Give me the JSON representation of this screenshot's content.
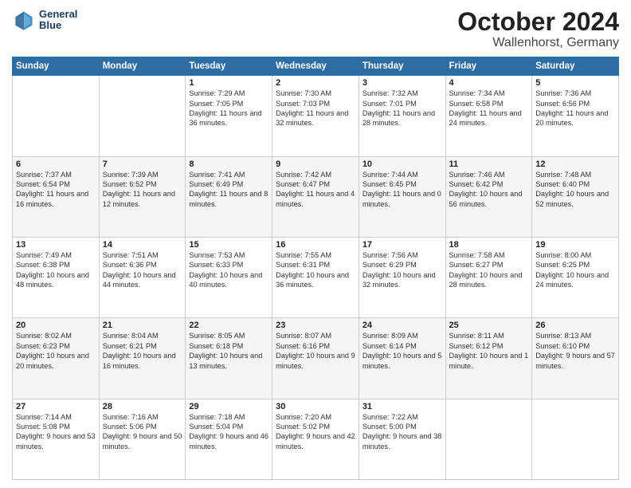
{
  "logo": {
    "line1": "General",
    "line2": "Blue"
  },
  "title": "October 2024",
  "subtitle": "Wallenhorst, Germany",
  "days_of_week": [
    "Sunday",
    "Monday",
    "Tuesday",
    "Wednesday",
    "Thursday",
    "Friday",
    "Saturday"
  ],
  "weeks": [
    [
      {
        "day": "",
        "sunrise": "",
        "sunset": "",
        "daylight": ""
      },
      {
        "day": "",
        "sunrise": "",
        "sunset": "",
        "daylight": ""
      },
      {
        "day": "1",
        "sunrise": "Sunrise: 7:29 AM",
        "sunset": "Sunset: 7:05 PM",
        "daylight": "Daylight: 11 hours and 36 minutes."
      },
      {
        "day": "2",
        "sunrise": "Sunrise: 7:30 AM",
        "sunset": "Sunset: 7:03 PM",
        "daylight": "Daylight: 11 hours and 32 minutes."
      },
      {
        "day": "3",
        "sunrise": "Sunrise: 7:32 AM",
        "sunset": "Sunset: 7:01 PM",
        "daylight": "Daylight: 11 hours and 28 minutes."
      },
      {
        "day": "4",
        "sunrise": "Sunrise: 7:34 AM",
        "sunset": "Sunset: 6:58 PM",
        "daylight": "Daylight: 11 hours and 24 minutes."
      },
      {
        "day": "5",
        "sunrise": "Sunrise: 7:36 AM",
        "sunset": "Sunset: 6:56 PM",
        "daylight": "Daylight: 11 hours and 20 minutes."
      }
    ],
    [
      {
        "day": "6",
        "sunrise": "Sunrise: 7:37 AM",
        "sunset": "Sunset: 6:54 PM",
        "daylight": "Daylight: 11 hours and 16 minutes."
      },
      {
        "day": "7",
        "sunrise": "Sunrise: 7:39 AM",
        "sunset": "Sunset: 6:52 PM",
        "daylight": "Daylight: 11 hours and 12 minutes."
      },
      {
        "day": "8",
        "sunrise": "Sunrise: 7:41 AM",
        "sunset": "Sunset: 6:49 PM",
        "daylight": "Daylight: 11 hours and 8 minutes."
      },
      {
        "day": "9",
        "sunrise": "Sunrise: 7:42 AM",
        "sunset": "Sunset: 6:47 PM",
        "daylight": "Daylight: 11 hours and 4 minutes."
      },
      {
        "day": "10",
        "sunrise": "Sunrise: 7:44 AM",
        "sunset": "Sunset: 6:45 PM",
        "daylight": "Daylight: 11 hours and 0 minutes."
      },
      {
        "day": "11",
        "sunrise": "Sunrise: 7:46 AM",
        "sunset": "Sunset: 6:42 PM",
        "daylight": "Daylight: 10 hours and 56 minutes."
      },
      {
        "day": "12",
        "sunrise": "Sunrise: 7:48 AM",
        "sunset": "Sunset: 6:40 PM",
        "daylight": "Daylight: 10 hours and 52 minutes."
      }
    ],
    [
      {
        "day": "13",
        "sunrise": "Sunrise: 7:49 AM",
        "sunset": "Sunset: 6:38 PM",
        "daylight": "Daylight: 10 hours and 48 minutes."
      },
      {
        "day": "14",
        "sunrise": "Sunrise: 7:51 AM",
        "sunset": "Sunset: 6:36 PM",
        "daylight": "Daylight: 10 hours and 44 minutes."
      },
      {
        "day": "15",
        "sunrise": "Sunrise: 7:53 AM",
        "sunset": "Sunset: 6:33 PM",
        "daylight": "Daylight: 10 hours and 40 minutes."
      },
      {
        "day": "16",
        "sunrise": "Sunrise: 7:55 AM",
        "sunset": "Sunset: 6:31 PM",
        "daylight": "Daylight: 10 hours and 36 minutes."
      },
      {
        "day": "17",
        "sunrise": "Sunrise: 7:56 AM",
        "sunset": "Sunset: 6:29 PM",
        "daylight": "Daylight: 10 hours and 32 minutes."
      },
      {
        "day": "18",
        "sunrise": "Sunrise: 7:58 AM",
        "sunset": "Sunset: 6:27 PM",
        "daylight": "Daylight: 10 hours and 28 minutes."
      },
      {
        "day": "19",
        "sunrise": "Sunrise: 8:00 AM",
        "sunset": "Sunset: 6:25 PM",
        "daylight": "Daylight: 10 hours and 24 minutes."
      }
    ],
    [
      {
        "day": "20",
        "sunrise": "Sunrise: 8:02 AM",
        "sunset": "Sunset: 6:23 PM",
        "daylight": "Daylight: 10 hours and 20 minutes."
      },
      {
        "day": "21",
        "sunrise": "Sunrise: 8:04 AM",
        "sunset": "Sunset: 6:21 PM",
        "daylight": "Daylight: 10 hours and 16 minutes."
      },
      {
        "day": "22",
        "sunrise": "Sunrise: 8:05 AM",
        "sunset": "Sunset: 6:18 PM",
        "daylight": "Daylight: 10 hours and 13 minutes."
      },
      {
        "day": "23",
        "sunrise": "Sunrise: 8:07 AM",
        "sunset": "Sunset: 6:16 PM",
        "daylight": "Daylight: 10 hours and 9 minutes."
      },
      {
        "day": "24",
        "sunrise": "Sunrise: 8:09 AM",
        "sunset": "Sunset: 6:14 PM",
        "daylight": "Daylight: 10 hours and 5 minutes."
      },
      {
        "day": "25",
        "sunrise": "Sunrise: 8:11 AM",
        "sunset": "Sunset: 6:12 PM",
        "daylight": "Daylight: 10 hours and 1 minute."
      },
      {
        "day": "26",
        "sunrise": "Sunrise: 8:13 AM",
        "sunset": "Sunset: 6:10 PM",
        "daylight": "Daylight: 9 hours and 57 minutes."
      }
    ],
    [
      {
        "day": "27",
        "sunrise": "Sunrise: 7:14 AM",
        "sunset": "Sunset: 5:08 PM",
        "daylight": "Daylight: 9 hours and 53 minutes."
      },
      {
        "day": "28",
        "sunrise": "Sunrise: 7:16 AM",
        "sunset": "Sunset: 5:06 PM",
        "daylight": "Daylight: 9 hours and 50 minutes."
      },
      {
        "day": "29",
        "sunrise": "Sunrise: 7:18 AM",
        "sunset": "Sunset: 5:04 PM",
        "daylight": "Daylight: 9 hours and 46 minutes."
      },
      {
        "day": "30",
        "sunrise": "Sunrise: 7:20 AM",
        "sunset": "Sunset: 5:02 PM",
        "daylight": "Daylight: 9 hours and 42 minutes."
      },
      {
        "day": "31",
        "sunrise": "Sunrise: 7:22 AM",
        "sunset": "Sunset: 5:00 PM",
        "daylight": "Daylight: 9 hours and 38 minutes."
      },
      {
        "day": "",
        "sunrise": "",
        "sunset": "",
        "daylight": ""
      },
      {
        "day": "",
        "sunrise": "",
        "sunset": "",
        "daylight": ""
      }
    ]
  ]
}
